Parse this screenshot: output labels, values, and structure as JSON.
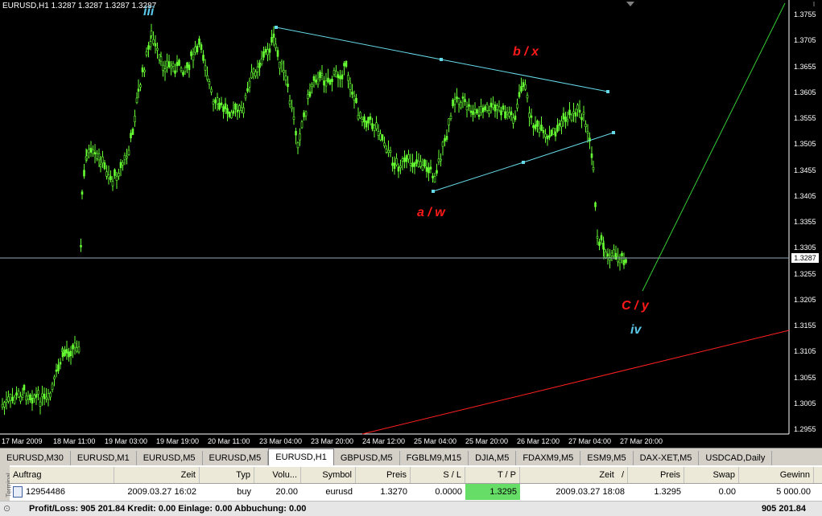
{
  "chart": {
    "title": "EURUSD,H1  1.3287 1.3287 1.3287 1.3287",
    "current_price": "1.3287",
    "y_ticks": [
      "1.3755",
      "1.3705",
      "1.3655",
      "1.3605",
      "1.3555",
      "1.3505",
      "1.3455",
      "1.3405",
      "1.3355",
      "1.3305",
      "1.3255",
      "1.3205",
      "1.3155",
      "1.3105",
      "1.3055",
      "1.3005",
      "1.2955"
    ],
    "x_ticks": [
      "17 Mar 2009",
      "18 Mar 11:00",
      "19 Mar 03:00",
      "19 Mar 19:00",
      "20 Mar 11:00",
      "23 Mar 04:00",
      "23 Mar 20:00",
      "24 Mar 12:00",
      "25 Mar 04:00",
      "25 Mar 20:00",
      "26 Mar 12:00",
      "27 Mar 04:00",
      "27 Mar 20:00"
    ],
    "wave_labels": {
      "iii": "iii",
      "b_x": "b / x",
      "a_w": "a / w",
      "c_y": "C / y",
      "iv": "iv"
    },
    "colors": {
      "candles": "#66ff33",
      "channel": "#66d9e8",
      "support": "#ff2020",
      "projection": "#33cc33",
      "wave_red": "#ff1a1a",
      "wave_cyan": "#5ac8e8"
    }
  },
  "tabs": [
    {
      "label": "EURUSD,M30"
    },
    {
      "label": "EURUSD,M1"
    },
    {
      "label": "EURUSD,M5"
    },
    {
      "label": "EURUSD,M5"
    },
    {
      "label": "EURUSD,H1",
      "active": true
    },
    {
      "label": "GBPUSD,M5"
    },
    {
      "label": "FGBLM9,M15"
    },
    {
      "label": "DJIA,M5"
    },
    {
      "label": "FDAXM9,M5"
    },
    {
      "label": "ESM9,M5"
    },
    {
      "label": "DAX-XET,M5"
    },
    {
      "label": "USDCAD,Daily"
    }
  ],
  "terminal": {
    "side_label": "Terminal",
    "headers": {
      "auftrag": "Auftrag",
      "zeit": "Zeit",
      "typ": "Typ",
      "volume": "Volu...",
      "symbol": "Symbol",
      "preis": "Preis",
      "sl": "S / L",
      "tp": "T / P",
      "zeit2": "Zeit",
      "sort_marker": "/",
      "preis2": "Preis",
      "swap": "Swap",
      "gewinn": "Gewinn"
    },
    "order": {
      "auftrag": "12954486",
      "zeit": "2009.03.27 16:02",
      "typ": "buy",
      "volume": "20.00",
      "symbol": "eurusd",
      "preis": "1.3270",
      "sl": "0.0000",
      "tp": "1.3295",
      "zeit2": "2009.03.27 18:08",
      "preis2": "1.3295",
      "swap": "0.00",
      "gewinn": "5 000.00"
    },
    "status_icon": "⊙",
    "status_text": "Profit/Loss: 905 201.84  Kredit: 0.00  Einlage: 0.00  Abbuchung: 0.00",
    "status_total": "905 201.84"
  }
}
